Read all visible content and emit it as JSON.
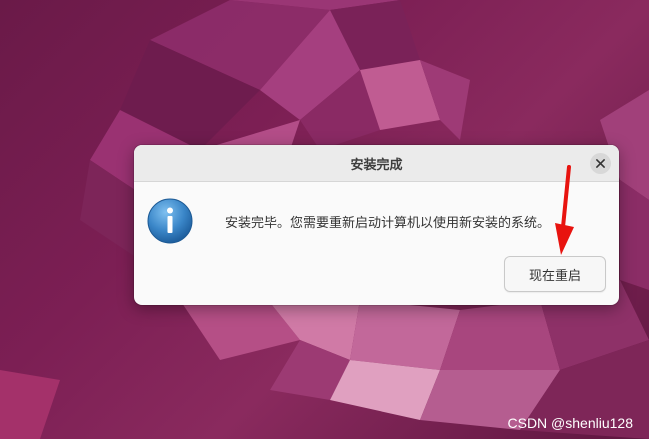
{
  "dialog": {
    "title": "安装完成",
    "message": "安装完毕。您需要重新启动计算机以使用新安装的系统。",
    "button_label": "现在重启",
    "icon": "info-icon",
    "close_icon": "close-icon"
  },
  "annotation": {
    "arrow_color": "#e8130f"
  },
  "watermark": "CSDN @shenliu128",
  "colors": {
    "wallpaper": "#7c1f54",
    "dialog_bg": "#fafafa",
    "titlebar_bg": "#ebebeb",
    "info_icon": "#3a86c8"
  }
}
